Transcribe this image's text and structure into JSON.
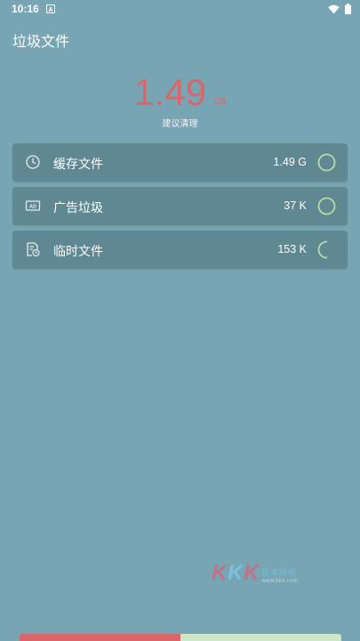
{
  "status_bar": {
    "time": "10:16",
    "icons": [
      "notification-a-icon",
      "wifi-icon",
      "battery-icon"
    ]
  },
  "page": {
    "title": "垃圾文件"
  },
  "total": {
    "value": "1.49",
    "unit": "GB",
    "hint": "建议清理"
  },
  "items": [
    {
      "icon": "clock-icon",
      "label": "缓存文件",
      "size": "1.49 G",
      "state": "done"
    },
    {
      "icon": "ad-icon",
      "label": "广告垃圾",
      "size": "37 K",
      "state": "done"
    },
    {
      "icon": "temp-file-icon",
      "label": "临时文件",
      "size": "153 K",
      "state": "scanning"
    }
  ],
  "watermark": {
    "brand": "KKK",
    "text": "安卓网站",
    "sub": "www.kkx.com"
  },
  "colors": {
    "background": "#78a5b4",
    "card": "#5f8892",
    "accent_red": "#d9676a",
    "check_green": "#b6dba8"
  }
}
